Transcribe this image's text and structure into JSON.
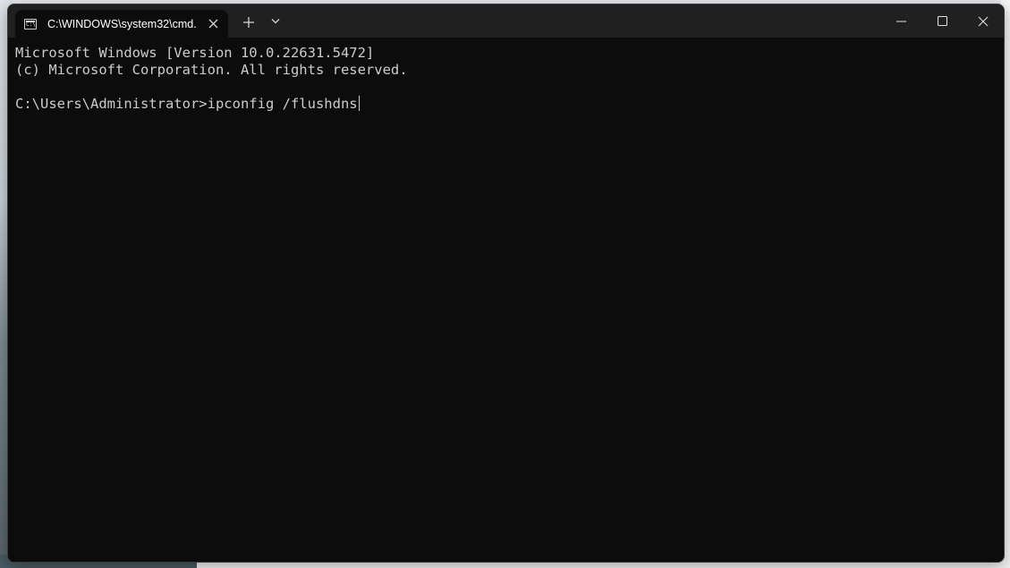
{
  "window": {
    "tab_title": "C:\\WINDOWS\\system32\\cmd.",
    "icons": {
      "tab": "cmd-icon",
      "close_tab": "close-icon",
      "new_tab": "plus-icon",
      "dropdown": "chevron-down-icon",
      "minimize": "minimize-icon",
      "maximize": "maximize-icon",
      "close_window": "close-icon"
    }
  },
  "terminal": {
    "lines": [
      "Microsoft Windows [Version 10.0.22631.5472]",
      "(c) Microsoft Corporation. All rights reserved.",
      "",
      ""
    ],
    "prompt": "C:\\Users\\Administrator>",
    "command": "ipconfig /flushdns"
  },
  "colors": {
    "terminal_bg": "#0c0c0c",
    "titlebar_bg": "#202020",
    "text": "#cccccc"
  }
}
